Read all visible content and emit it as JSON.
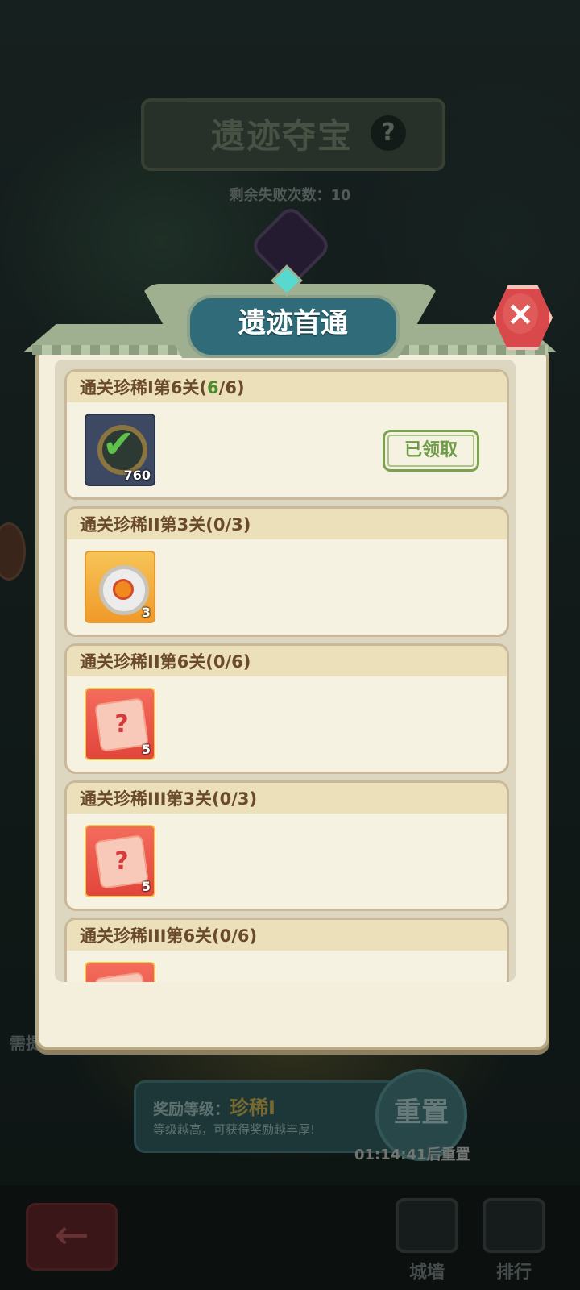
{
  "background": {
    "title": "遗迹夺宝",
    "help_icon": "?",
    "fail_count_label": "剩余失败次数：10",
    "need_text": "需提升关卡",
    "reward_level_label": "奖励等级：",
    "reward_level_value": "珍稀I",
    "reward_hint": "等级越高，可获得奖励越丰厚!",
    "reset_button": "重置",
    "reset_timer": "01:14:41后重置",
    "nav": {
      "wall": "城墙",
      "rank": "排行"
    }
  },
  "modal": {
    "title": "遗迹首通",
    "close_icon": "×",
    "rows": [
      {
        "prefix": "通关珍稀I第6关(",
        "progress_done": "6",
        "suffix": "/6)",
        "item_count": "760",
        "item_icon": "check-badge-icon",
        "status": "已领取"
      },
      {
        "title": "通关珍稀II第3关(0/3)",
        "item_count": "3",
        "item_icon": "disc-icon"
      },
      {
        "title": "通关珍稀II第6关(0/6)",
        "item_count": "5",
        "item_icon": "mystery-gear-scroll-icon"
      },
      {
        "title": "通关珍稀III第3关(0/3)",
        "item_count": "5",
        "item_icon": "mystery-gear-scroll-icon"
      },
      {
        "title": "通关珍稀III第6关(0/6)",
        "item_icon": "scroll-icon"
      }
    ]
  }
}
